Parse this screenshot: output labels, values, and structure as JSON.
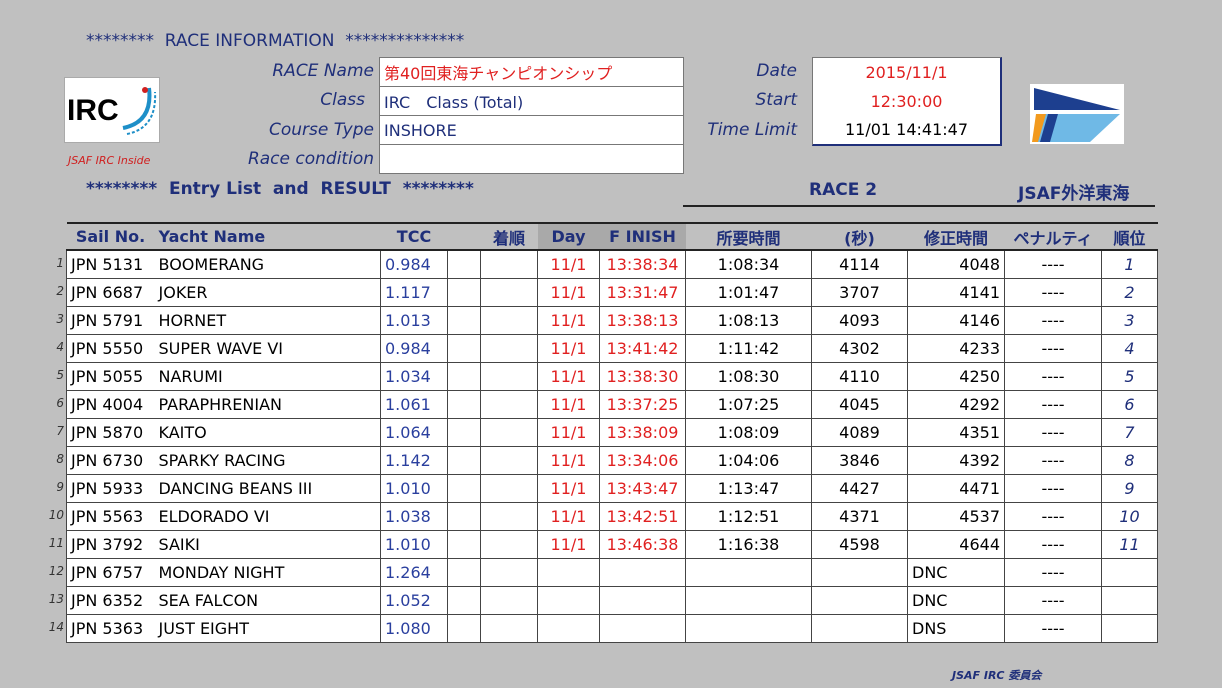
{
  "header": {
    "title": "********  RACE INFORMATION  **************",
    "labels": {
      "race_name": "RACE Name",
      "class": "Class",
      "course_type": "Course Type",
      "race_condition": "Race condition",
      "date": "Date",
      "start": "Start",
      "time_limit": "Time Limit"
    },
    "values": {
      "race_name": "第40回東海チャンピオンシップ",
      "class": "IRC　Class (Total)",
      "course_type": "INSHORE",
      "race_condition": "",
      "date": "2015/11/1",
      "start": "12:30:00",
      "time_limit": "11/01 14:41:47"
    },
    "logo_text": "IRC",
    "logo_caption": "JSAF IRC Inside"
  },
  "entry": {
    "title": "********  Entry List  and  RESULT  ********",
    "race": "RACE 2",
    "organizer": "JSAF外洋東海"
  },
  "table": {
    "headers": [
      "Sail No.",
      "Yacht Name",
      "TCC",
      "",
      "着順",
      "Day",
      "F INISH",
      "所要時間",
      "(秒)",
      "修正時間",
      "ペナルティ",
      "順位"
    ],
    "rows": [
      {
        "n": "1",
        "sail": "JPN 5131",
        "name": "BOOMERANG",
        "tcc": "0.984",
        "chaku": "",
        "day": "11/1",
        "finish": "13:38:34",
        "elapsed": "1:08:34",
        "sec": "4114",
        "corr": "4048",
        "pen": "----",
        "rank": "1"
      },
      {
        "n": "2",
        "sail": "JPN 6687",
        "name": "JOKER",
        "tcc": "1.117",
        "chaku": "",
        "day": "11/1",
        "finish": "13:31:47",
        "elapsed": "1:01:47",
        "sec": "3707",
        "corr": "4141",
        "pen": "----",
        "rank": "2"
      },
      {
        "n": "3",
        "sail": "JPN 5791",
        "name": "HORNET",
        "tcc": "1.013",
        "chaku": "",
        "day": "11/1",
        "finish": "13:38:13",
        "elapsed": "1:08:13",
        "sec": "4093",
        "corr": "4146",
        "pen": "----",
        "rank": "3"
      },
      {
        "n": "4",
        "sail": "JPN 5550",
        "name": "SUPER WAVE VI",
        "tcc": "0.984",
        "chaku": "",
        "day": "11/1",
        "finish": "13:41:42",
        "elapsed": "1:11:42",
        "sec": "4302",
        "corr": "4233",
        "pen": "----",
        "rank": "4"
      },
      {
        "n": "5",
        "sail": "JPN 5055",
        "name": "NARUMI",
        "tcc": "1.034",
        "chaku": "",
        "day": "11/1",
        "finish": "13:38:30",
        "elapsed": "1:08:30",
        "sec": "4110",
        "corr": "4250",
        "pen": "----",
        "rank": "5"
      },
      {
        "n": "6",
        "sail": "JPN 4004",
        "name": "PARAPHRENIAN",
        "tcc": "1.061",
        "chaku": "",
        "day": "11/1",
        "finish": "13:37:25",
        "elapsed": "1:07:25",
        "sec": "4045",
        "corr": "4292",
        "pen": "----",
        "rank": "6"
      },
      {
        "n": "7",
        "sail": "JPN 5870",
        "name": "KAITO",
        "tcc": "1.064",
        "chaku": "",
        "day": "11/1",
        "finish": "13:38:09",
        "elapsed": "1:08:09",
        "sec": "4089",
        "corr": "4351",
        "pen": "----",
        "rank": "7"
      },
      {
        "n": "8",
        "sail": "JPN 6730",
        "name": "SPARKY RACING",
        "tcc": "1.142",
        "chaku": "",
        "day": "11/1",
        "finish": "13:34:06",
        "elapsed": "1:04:06",
        "sec": "3846",
        "corr": "4392",
        "pen": "----",
        "rank": "8"
      },
      {
        "n": "9",
        "sail": "JPN 5933",
        "name": "DANCING BEANS III",
        "tcc": "1.010",
        "chaku": "",
        "day": "11/1",
        "finish": "13:43:47",
        "elapsed": "1:13:47",
        "sec": "4427",
        "corr": "4471",
        "pen": "----",
        "rank": "9"
      },
      {
        "n": "10",
        "sail": "JPN 5563",
        "name": "ELDORADO VI",
        "tcc": "1.038",
        "chaku": "",
        "day": "11/1",
        "finish": "13:42:51",
        "elapsed": "1:12:51",
        "sec": "4371",
        "corr": "4537",
        "pen": "----",
        "rank": "10"
      },
      {
        "n": "11",
        "sail": "JPN 3792",
        "name": "SAIKI",
        "tcc": "1.010",
        "chaku": "",
        "day": "11/1",
        "finish": "13:46:38",
        "elapsed": "1:16:38",
        "sec": "4598",
        "corr": "4644",
        "pen": "----",
        "rank": "11"
      },
      {
        "n": "12",
        "sail": "JPN 6757",
        "name": "MONDAY NIGHT",
        "tcc": "1.264",
        "chaku": "",
        "day": "",
        "finish": "",
        "elapsed": "",
        "sec": "",
        "corr": "DNC",
        "pen": "----",
        "rank": ""
      },
      {
        "n": "13",
        "sail": "JPN 6352",
        "name": "SEA FALCON",
        "tcc": "1.052",
        "chaku": "",
        "day": "",
        "finish": "",
        "elapsed": "",
        "sec": "",
        "corr": "DNC",
        "pen": "----",
        "rank": ""
      },
      {
        "n": "14",
        "sail": "JPN 5363",
        "name": "JUST EIGHT",
        "tcc": "1.080",
        "chaku": "",
        "day": "",
        "finish": "",
        "elapsed": "",
        "sec": "",
        "corr": "DNS",
        "pen": "----",
        "rank": ""
      }
    ]
  },
  "footer": "JSAF IRC 委員会",
  "colors": {
    "navy": "#1f2f7a",
    "red": "#e02020",
    "background": "#c0c0c0"
  }
}
